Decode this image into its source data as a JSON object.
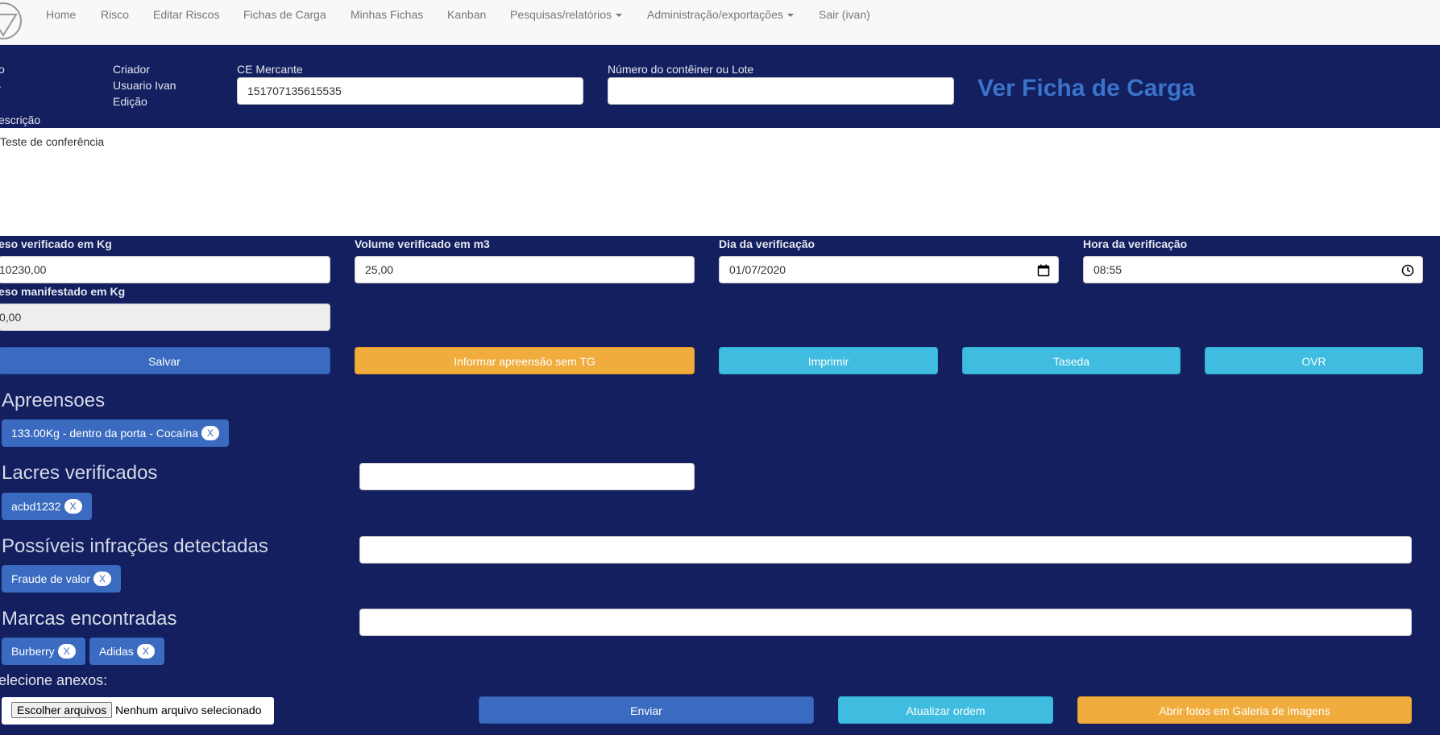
{
  "navbar": {
    "items": [
      "Home",
      "Risco",
      "Editar Riscos",
      "Fichas de Carga",
      "Minhas Fichas",
      "Kanban",
      "Pesquisas/relatórios",
      "Administração/exportações",
      "Sair (ivan)"
    ]
  },
  "header": {
    "left_col_1": "o",
    "left_col_2": ".",
    "criador_label": "Criador",
    "criador_value": "Usuario Ivan",
    "edicao_label": "Edição",
    "ce_mercante_label": "CE Mercante",
    "ce_mercante_value": "151707135615535",
    "conteiner_label": "Número do contêiner ou Lote",
    "conteiner_value": "",
    "ver_ficha_link": "Ver Ficha de Carga"
  },
  "descricao": {
    "label": "escrição",
    "value": "Teste de conferência"
  },
  "verificacao": {
    "peso_label": "eso verificado em Kg",
    "peso_value": "10230,00",
    "volume_label": "Volume verificado em m3",
    "volume_value": "25,00",
    "dia_label": "Dia da verificação",
    "dia_value": "01/07/2020",
    "hora_label": "Hora da verificação",
    "hora_value": "08:55",
    "peso_manifestado_label": "eso manifestado em Kg",
    "peso_manifestado_value": "0,00"
  },
  "actions": {
    "salvar": "Salvar",
    "informar_apreensao": "Informar apreensão sem TG",
    "imprimir": "Imprimir",
    "taseda": "Taseda",
    "ovr": "OVR"
  },
  "apreensoes": {
    "title": "Apreensoes",
    "tags": [
      {
        "label": "133.00Kg - dentro da porta - Cocaína",
        "remove": "X"
      }
    ]
  },
  "lacres": {
    "title": "Lacres verificados",
    "input_value": "",
    "tags": [
      {
        "label": "acbd1232",
        "remove": "X"
      }
    ]
  },
  "infracoes": {
    "title": "Possíveis infrações detectadas",
    "input_value": "",
    "tags": [
      {
        "label": "Fraude de valor",
        "remove": "X"
      }
    ]
  },
  "marcas": {
    "title": "Marcas encontradas",
    "input_value": "",
    "tags": [
      {
        "label": "Burberry",
        "remove": "X"
      },
      {
        "label": "Adidas",
        "remove": "X"
      }
    ]
  },
  "anexos": {
    "label": "elecione anexos:",
    "file_button": "Escolher arquivos",
    "file_status": "Nenhum arquivo selecionado",
    "enviar": "Enviar",
    "atualizar_ordem": "Atualizar ordem",
    "abrir_galeria": "Abrir fotos em Galeria de imagens"
  },
  "colors": {
    "background": "#131f5f",
    "primary": "#3a6bc0",
    "warning": "#f0ad3e",
    "info": "#3fbcdf",
    "link": "#3a73c9"
  }
}
